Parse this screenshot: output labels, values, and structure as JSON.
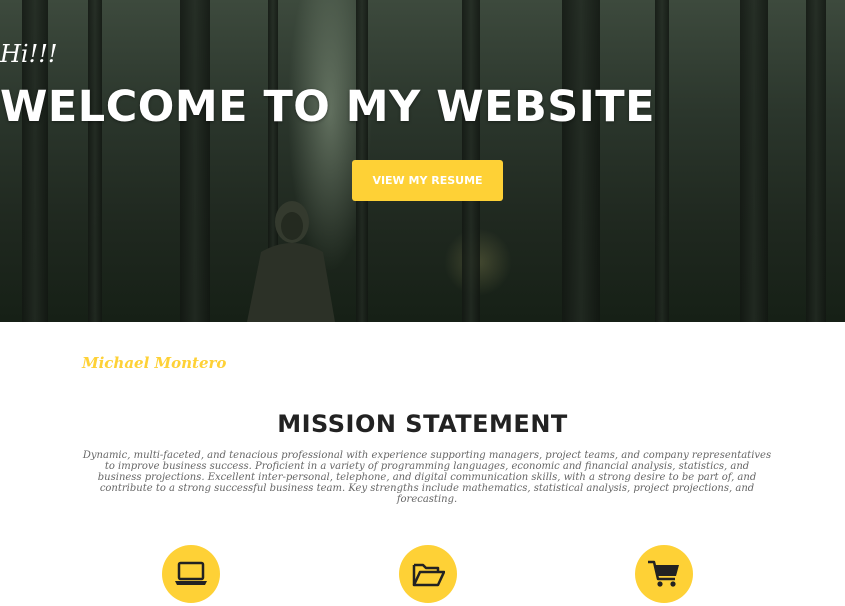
{
  "hero": {
    "greeting": "Hi!!!",
    "heading": "WELCOME TO MY WEBSITE",
    "resume_button": "VIEW MY RESUME"
  },
  "about": {
    "name": "Michael Montero",
    "mission_title": "MISSION STATEMENT",
    "mission_text": "Dynamic, multi-faceted, and tenacious professional with experience supporting managers, project teams, and company representatives to improve business success. Proficient in a variety of programming languages, economic and financial analysis, statistics, and business projections. Excellent inter-personal, telephone, and digital communication skills, with a strong desire to be part of, and contribute to a strong successful business team. Key strengths include mathematics, statistical analysis, project projections, and forecasting."
  },
  "services": [
    {
      "icon": "laptop-icon"
    },
    {
      "icon": "folder-open-icon"
    },
    {
      "icon": "shopping-cart-icon"
    }
  ],
  "colors": {
    "accent": "#fed136",
    "heading": "#222222",
    "body_text": "#666666"
  }
}
